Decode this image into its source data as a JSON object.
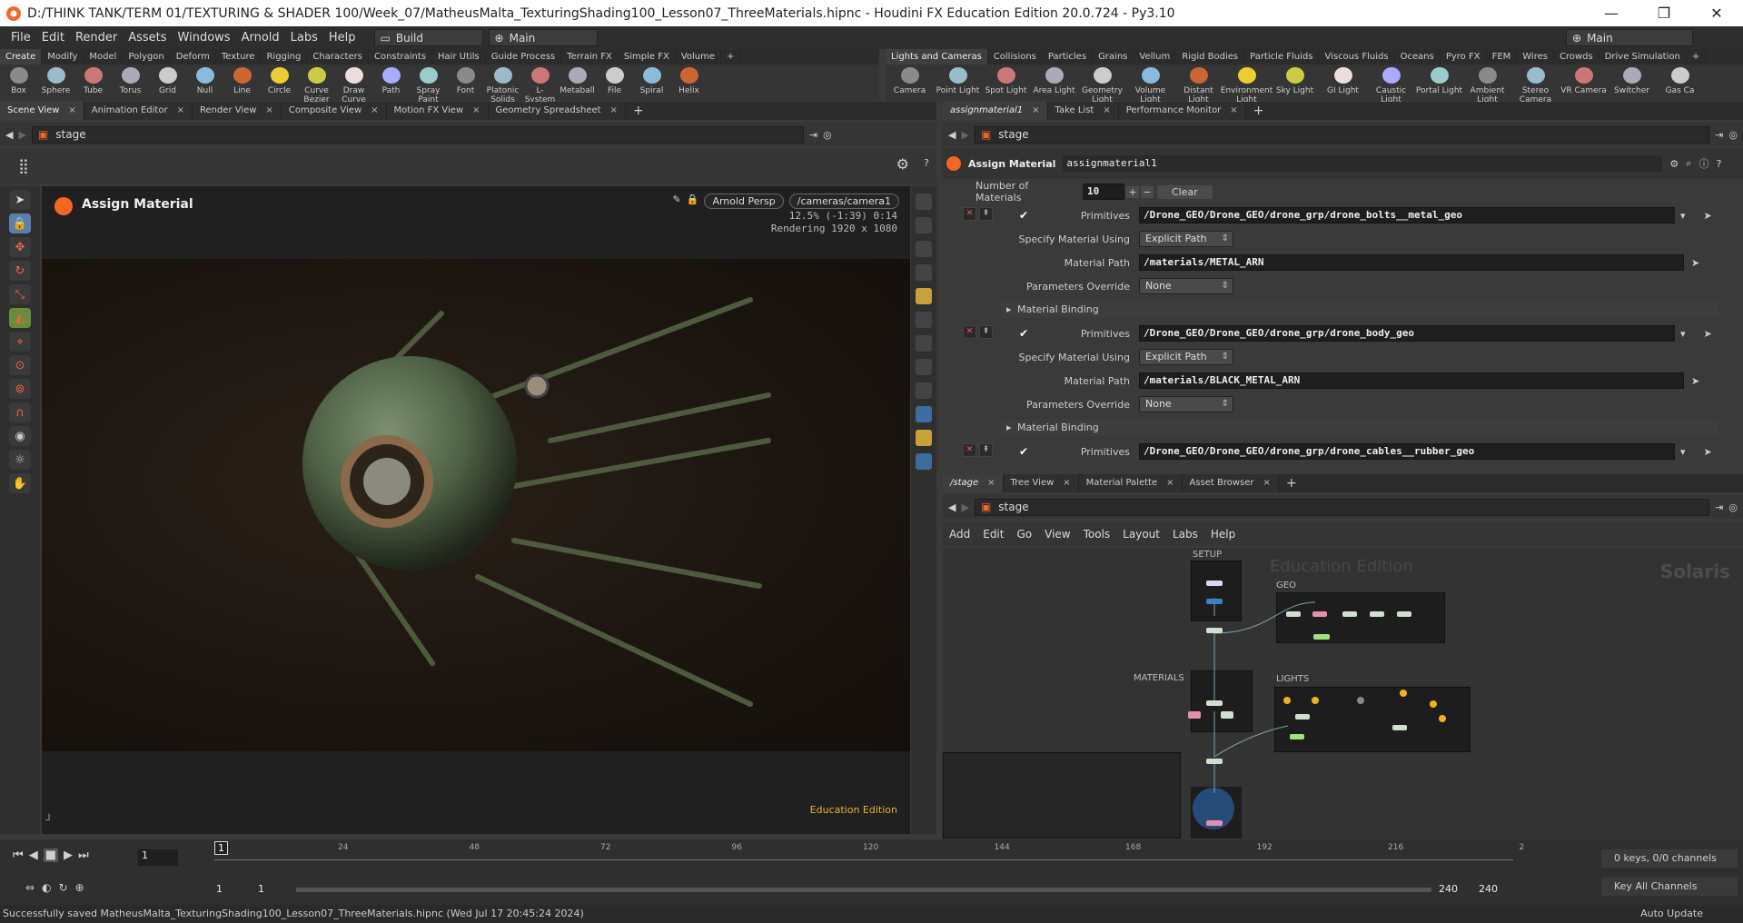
{
  "window": {
    "title": "D:/THINK TANK/TERM 01/TEXTURING & SHADER 100/Week_07/MatheusMalta_TexturingShading100_Lesson07_ThreeMaterials.hipnc - Houdini FX Education Edition 20.0.724 - Py3.10",
    "minimize": "—",
    "maximize": "❐",
    "close": "✕"
  },
  "menu": {
    "items": [
      "File",
      "Edit",
      "Render",
      "Assets",
      "Windows",
      "Arnold",
      "Labs",
      "Help"
    ],
    "desktop": "Build",
    "context": "Main",
    "right_context": "Main"
  },
  "shelf_left": {
    "tabs": [
      "Create",
      "Modify",
      "Model",
      "Polygon",
      "Deform",
      "Texture",
      "Rigging",
      "Characters",
      "Constraints",
      "Hair Utils",
      "Guide Process",
      "Terrain FX",
      "Simple FX",
      "Volume",
      "+"
    ],
    "tools": [
      "Box",
      "Sphere",
      "Tube",
      "Torus",
      "Grid",
      "Null",
      "Line",
      "Circle",
      "Curve Bezier",
      "Draw Curve",
      "Path",
      "Spray Paint",
      "Font",
      "Platonic Solids",
      "L-System",
      "Metaball",
      "File",
      "Spiral",
      "Helix"
    ]
  },
  "shelf_right": {
    "tabs": [
      "Lights and Cameras",
      "Collisions",
      "Particles",
      "Grains",
      "Vellum",
      "Rigid Bodies",
      "Particle Fluids",
      "Viscous Fluids",
      "Oceans",
      "Pyro FX",
      "FEM",
      "Wires",
      "Crowds",
      "Drive Simulation",
      "+"
    ],
    "tools": [
      "Camera",
      "Point Light",
      "Spot Light",
      "Area Light",
      "Geometry Light",
      "Volume Light",
      "Distant Light",
      "Environment Light",
      "Sky Light",
      "GI Light",
      "Caustic Light",
      "Portal Light",
      "Ambient Light",
      "Stereo Camera",
      "VR Camera",
      "Switcher",
      "Gas Ca"
    ]
  },
  "left_pane": {
    "tabs": [
      "Scene View",
      "Animation Editor",
      "Render View",
      "Composite View",
      "Motion FX View",
      "Geometry Spreadsheet"
    ],
    "path": "stage"
  },
  "viewport": {
    "title": "Assign Material",
    "renderer": "Arnold Persp",
    "camera": "/cameras/camera1",
    "stats_line1": "12.5%  (-1:39)  0:14",
    "stats_line2": "Rendering 1920 x 1080",
    "edition": "Education Edition"
  },
  "right_pane": {
    "tabs": [
      "assignmaterial1",
      "Take List",
      "Performance Monitor"
    ],
    "path": "stage",
    "node_type": "Assign Material",
    "node_name": "assignmaterial1"
  },
  "parms": {
    "num_label": "Number of Materials",
    "num_value": "10",
    "clear": "Clear",
    "lbl_prims": "Primitives",
    "lbl_spec": "Specify Material Using",
    "lbl_path": "Material Path",
    "lbl_override": "Parameters Override",
    "binding": "Material Binding",
    "m1_prims": "/Drone_GEO/Drone_GEO/drone_grp/drone_bolts__metal_geo",
    "m1_spec": "Explicit Path",
    "m1_path": "/materials/METAL_ARN",
    "m1_override": "None",
    "m2_prims": "/Drone_GEO/Drone_GEO/drone_grp/drone_body_geo",
    "m2_spec": "Explicit Path",
    "m2_path": "/materials/BLACK_METAL_ARN",
    "m2_override": "None",
    "m3_prims": "/Drone_GEO/Drone_GEO/drone_grp/drone_cables__rubber_geo"
  },
  "net_pane": {
    "tabs": [
      "/stage",
      "Tree View",
      "Material Palette",
      "Asset Browser"
    ],
    "path": "stage",
    "menu": [
      "Add",
      "Edit",
      "Go",
      "View",
      "Tools",
      "Layout",
      "Labs",
      "Help"
    ],
    "watermark": "Education Edition",
    "context_label": "Solaris",
    "boxes": {
      "setup": "SETUP",
      "geo": "GEO",
      "materials": "MATERIALS",
      "lights": "LIGHTS"
    }
  },
  "timeline": {
    "ticks": [
      "24",
      "48",
      "72",
      "96",
      "120",
      "144",
      "168",
      "192",
      "216",
      "2"
    ],
    "frame": "1",
    "start": "1",
    "start2": "1",
    "end": "240",
    "end2": "240",
    "keys": "0 keys, 0/0 channels",
    "key_all": "Key All Channels",
    "auto_update": "Auto Update"
  },
  "status": "Successfully saved MatheusMalta_TexturingShading100_Lesson07_ThreeMaterials.hipnc (Wed Jul 17 20:45:24 2024)",
  "colors": {
    "accent": "#f26822",
    "edu": "#e6b428"
  }
}
